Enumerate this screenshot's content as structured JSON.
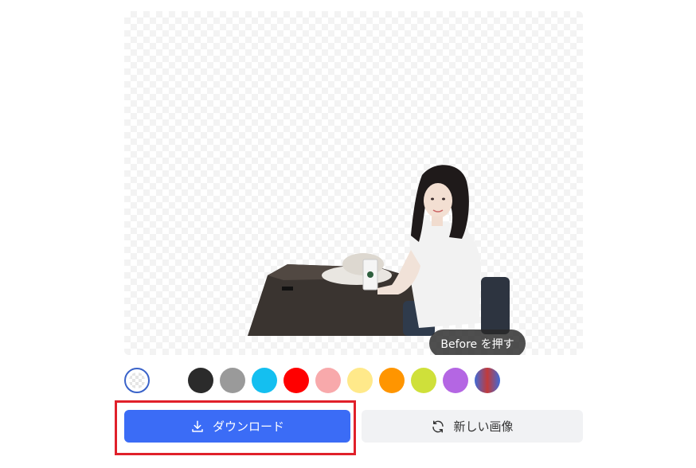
{
  "preview": {
    "before_label": "Before を押す"
  },
  "swatches": [
    {
      "name": "transparent",
      "color": "transparent",
      "selected": true
    },
    {
      "name": "white",
      "color": "#ffffff",
      "selected": false
    },
    {
      "name": "black",
      "color": "#2b2b2b",
      "selected": false
    },
    {
      "name": "gray",
      "color": "#9a9a9a",
      "selected": false
    },
    {
      "name": "cyan",
      "color": "#14bff0",
      "selected": false
    },
    {
      "name": "red",
      "color": "#ff0000",
      "selected": false
    },
    {
      "name": "pink",
      "color": "#f8a9ab",
      "selected": false
    },
    {
      "name": "light-yellow",
      "color": "#ffe98a",
      "selected": false
    },
    {
      "name": "orange",
      "color": "#ff9500",
      "selected": false
    },
    {
      "name": "lime",
      "color": "#cfe03a",
      "selected": false
    },
    {
      "name": "purple",
      "color": "#b466e3",
      "selected": false
    },
    {
      "name": "gradient",
      "color": "linear-gradient(90deg,#3f6bd8,#c23a3a,#3f6bd8)",
      "selected": false
    }
  ],
  "actions": {
    "download_label": "ダウンロード",
    "new_image_label": "新しい画像"
  },
  "colors": {
    "primary": "#3b6cf6",
    "highlight": "#e0202a",
    "selected_ring": "#3a63c9"
  }
}
